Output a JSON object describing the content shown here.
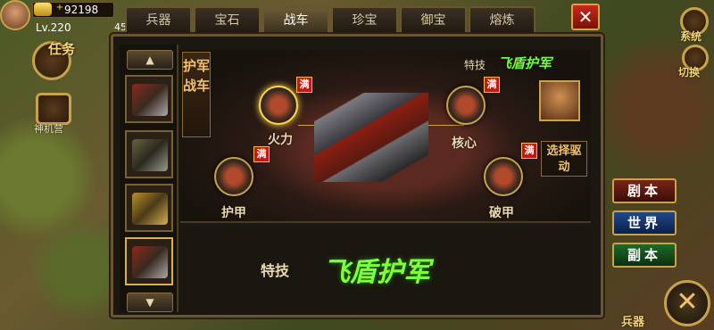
{
  "hud": {
    "gold": "92198",
    "level": "Lv.220",
    "level_extra": "45",
    "task_label": "任务",
    "shenji_label": "神机营"
  },
  "tabs": [
    {
      "label": "兵器",
      "active": false
    },
    {
      "label": "宝石",
      "active": false
    },
    {
      "label": "战车",
      "active": true
    },
    {
      "label": "珍宝",
      "active": false
    },
    {
      "label": "御宝",
      "active": false
    },
    {
      "label": "熔炼",
      "active": false
    }
  ],
  "close_label": "✕",
  "vertical_label": "护军战车",
  "skill": {
    "label": "特技",
    "name": "飞盾护军"
  },
  "nodes": {
    "huoli": {
      "label": "火力",
      "badge": "满"
    },
    "hexin": {
      "label": "核心",
      "badge": "满"
    },
    "hujia": {
      "label": "护甲",
      "badge": "满"
    },
    "pojia": {
      "label": "破甲",
      "badge": "满"
    }
  },
  "drive_button": "选择驱动",
  "right_hud": {
    "system": "系统",
    "switch": "切换",
    "bingqi": "兵器",
    "channels": [
      "剧本",
      "世界",
      "副本"
    ]
  },
  "colors": {
    "skill_green": "#7dff3a",
    "panel_border": "#6b5530",
    "badge_red": "#c01a10",
    "close_red": "#c8281c"
  },
  "icons": {
    "up_arrow": "▲",
    "down_arrow": "▼",
    "big_close": "✕"
  }
}
